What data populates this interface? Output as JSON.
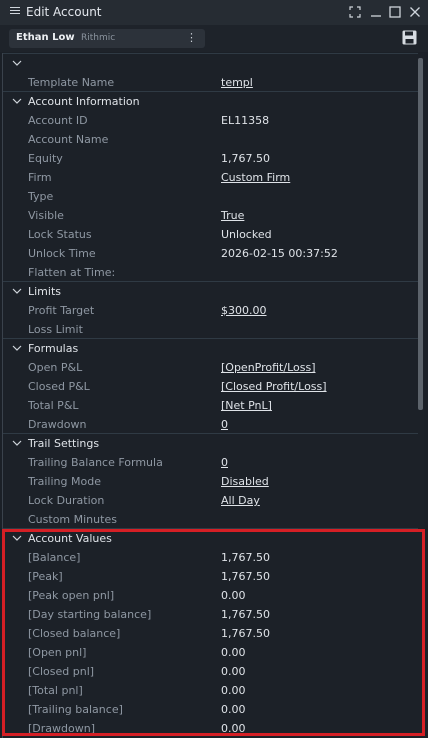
{
  "window": {
    "title": "Edit Account"
  },
  "toolbar": {
    "account_name": "Ethan Low",
    "connection": "Rithmic",
    "more_glyph": "⋮"
  },
  "general": {
    "template_label": "Template Name",
    "template_value": "templ"
  },
  "account_information": {
    "title": "Account Information",
    "rows": [
      {
        "label": "Account ID",
        "value": "EL11358"
      },
      {
        "label": "Account Name",
        "value": ""
      },
      {
        "label": "Equity",
        "value": "1,767.50"
      },
      {
        "label": "Firm",
        "value": "Custom Firm"
      },
      {
        "label": "Type",
        "value": ""
      },
      {
        "label": "Visible",
        "value": "True"
      },
      {
        "label": "Lock Status",
        "value": "Unlocked"
      },
      {
        "label": "Unlock Time",
        "value": "2026-02-15 00:37:52"
      },
      {
        "label": "Flatten at Time:",
        "value": ""
      }
    ]
  },
  "limits": {
    "title": "Limits",
    "rows": [
      {
        "label": "Profit Target",
        "value": "$300.00"
      },
      {
        "label": "Loss Limit",
        "value": ""
      }
    ]
  },
  "formulas": {
    "title": "Formulas",
    "rows": [
      {
        "label": "Open P&L",
        "value": "[OpenProfit/Loss]"
      },
      {
        "label": "Closed P&L",
        "value": "[Closed Profit/Loss]"
      },
      {
        "label": "Total P&L",
        "value": "[Net PnL]"
      },
      {
        "label": "Drawdown",
        "value": "0"
      }
    ]
  },
  "trail_settings": {
    "title": "Trail Settings",
    "rows": [
      {
        "label": "Trailing Balance Formula",
        "value": "0"
      },
      {
        "label": "Trailing Mode",
        "value": "Disabled"
      },
      {
        "label": "Lock Duration",
        "value": "All Day"
      },
      {
        "label": "Custom Minutes",
        "value": ""
      }
    ]
  },
  "account_values": {
    "title": "Account Values",
    "rows": [
      {
        "label": "[Balance]",
        "value": "1,767.50"
      },
      {
        "label": "[Peak]",
        "value": "1,767.50"
      },
      {
        "label": "[Peak open pnl]",
        "value": "0.00"
      },
      {
        "label": "[Day starting balance]",
        "value": "1,767.50"
      },
      {
        "label": "[Closed balance]",
        "value": "1,767.50"
      },
      {
        "label": "[Open pnl]",
        "value": "0.00"
      },
      {
        "label": "[Closed pnl]",
        "value": "0.00"
      },
      {
        "label": "[Total pnl]",
        "value": "0.00"
      },
      {
        "label": "[Trailing balance]",
        "value": "0.00"
      },
      {
        "label": "[Drawdown]",
        "value": "0.00"
      }
    ]
  },
  "colors": {
    "background": "#1b2027",
    "highlight": "#d51f25",
    "section_line": "#2f3a44"
  }
}
